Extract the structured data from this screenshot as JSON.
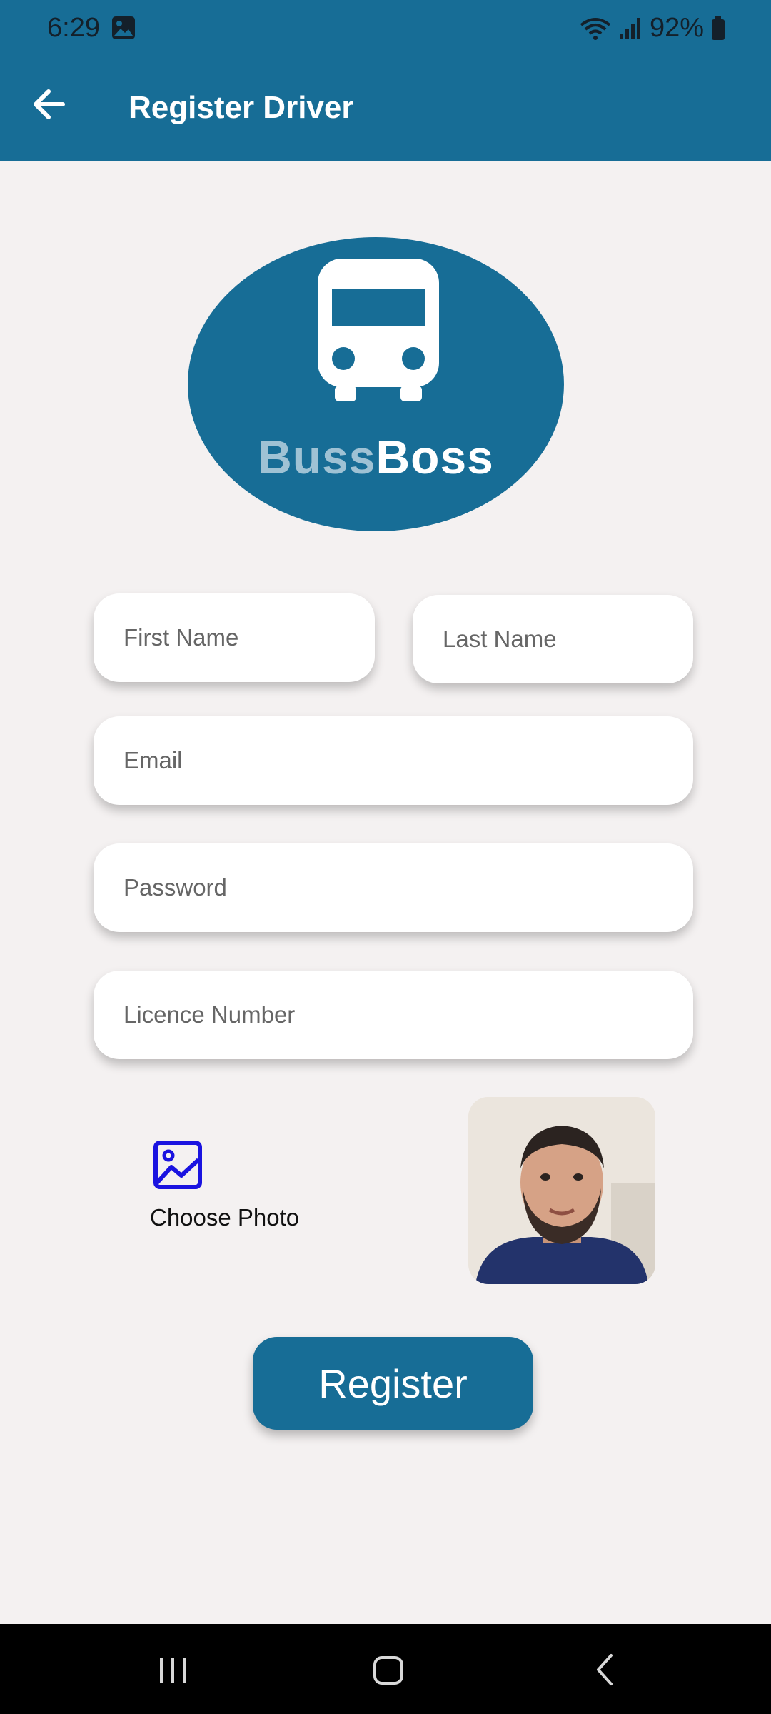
{
  "status_bar": {
    "time": "6:29",
    "battery": "92%"
  },
  "app_bar": {
    "title": "Register Driver"
  },
  "logo": {
    "text_part1": "Buss",
    "text_part2": "Boss"
  },
  "form": {
    "first_name_placeholder": "First Name",
    "last_name_placeholder": "Last Name",
    "email_placeholder": "Email",
    "password_placeholder": "Password",
    "licence_placeholder": "Licence Number"
  },
  "photo": {
    "choose_label": "Choose Photo"
  },
  "register_label": "Register",
  "colors": {
    "primary": "#176d96",
    "background": "#f4f1f1",
    "photo_icon": "#1a13e0"
  },
  "icons": [
    "back-arrow-icon",
    "image-icon",
    "bus-icon",
    "wifi-icon",
    "signal-icon",
    "battery-icon"
  ]
}
